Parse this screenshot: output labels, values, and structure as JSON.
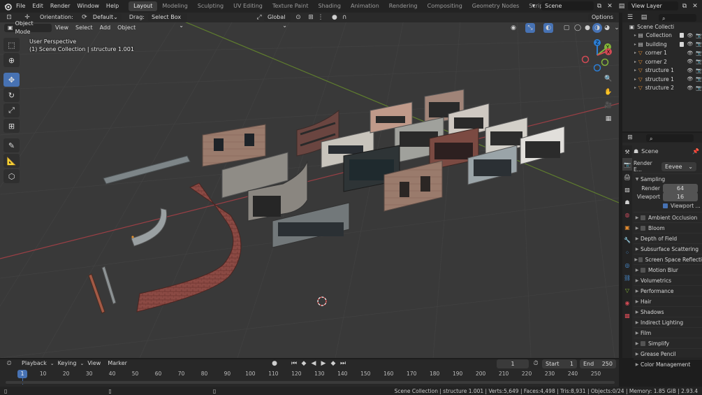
{
  "topbar": {
    "menus": [
      "File",
      "Edit",
      "Render",
      "Window",
      "Help"
    ],
    "workspaces": [
      "Layout",
      "Modeling",
      "Sculpting",
      "UV Editing",
      "Texture Paint",
      "Shading",
      "Animation",
      "Rendering",
      "Compositing",
      "Geometry Nodes",
      "Scripting"
    ],
    "active_workspace": "Layout",
    "add_workspace": "+",
    "scene": "Scene",
    "view_layer": "View Layer"
  },
  "tool_header": {
    "orientation_label": "Orientation:",
    "orientation_value": "Default",
    "drag_label": "Drag:",
    "drag_value": "Select Box",
    "transform_orientation": "Global",
    "options": "Options"
  },
  "viewport_header": {
    "mode": "Object Mode",
    "menus": [
      "View",
      "Select",
      "Add",
      "Object"
    ]
  },
  "viewport_overlay": {
    "line1": "User Perspective",
    "line2": "(1) Scene Collection | structure 1.001"
  },
  "gizmo": {
    "z": "Z",
    "y": "Y",
    "x": "X"
  },
  "outliner": {
    "root": "Scene Collecti",
    "items": [
      {
        "label": "Collection",
        "type": "collection"
      },
      {
        "label": "building",
        "type": "collection"
      },
      {
        "label": "corner 1",
        "type": "mesh"
      },
      {
        "label": "corner 2",
        "type": "mesh"
      },
      {
        "label": "structure 1",
        "type": "mesh"
      },
      {
        "label": "structure 1",
        "type": "mesh"
      },
      {
        "label": "structure 2",
        "type": "mesh"
      }
    ]
  },
  "properties": {
    "context": "Scene",
    "render_engine_label": "Render E...",
    "render_engine_value": "Eevee",
    "sampling_label": "Sampling",
    "render_label": "Render",
    "render_samples": "64",
    "viewport_label": "Viewport",
    "viewport_samples": "16",
    "viewport_denoise": "Viewport ...",
    "sections": [
      {
        "label": "Ambient Occlusion",
        "checkbox": true
      },
      {
        "label": "Bloom",
        "checkbox": true
      },
      {
        "label": "Depth of Field",
        "checkbox": false
      },
      {
        "label": "Subsurface Scattering",
        "checkbox": false
      },
      {
        "label": "Screen Space Reflecti",
        "checkbox": true
      },
      {
        "label": "Motion Blur",
        "checkbox": true
      },
      {
        "label": "Volumetrics",
        "checkbox": false
      },
      {
        "label": "Performance",
        "checkbox": false
      },
      {
        "label": "Hair",
        "checkbox": false
      },
      {
        "label": "Shadows",
        "checkbox": false
      },
      {
        "label": "Indirect Lighting",
        "checkbox": false
      },
      {
        "label": "Film",
        "checkbox": false
      },
      {
        "label": "Simplify",
        "checkbox": true
      },
      {
        "label": "Grease Pencil",
        "checkbox": false
      },
      {
        "label": "Color Management",
        "checkbox": false
      }
    ]
  },
  "timeline": {
    "menus": [
      "Playback",
      "Keying",
      "View",
      "Marker"
    ],
    "current_frame": "1",
    "start_label": "Start",
    "start_value": "1",
    "end_label": "End",
    "end_value": "250",
    "ruler": [
      "1",
      "10",
      "20",
      "30",
      "40",
      "50",
      "60",
      "70",
      "80",
      "90",
      "100",
      "110",
      "120",
      "130",
      "140",
      "150",
      "160",
      "170",
      "180",
      "190",
      "200",
      "210",
      "220",
      "230",
      "240",
      "250"
    ]
  },
  "statusbar": {
    "text": "Scene Collection | structure 1.001 | Verts:5,649 | Faces:4,498 | Tris:8,931 | Objects:0/24 | Memory: 1.85 GiB | 2.93.4"
  },
  "colors": {
    "accent": "#4772b3",
    "viewport_bg": "#393939",
    "panel_bg": "#282828",
    "x_axis": "#d24a54",
    "y_axis": "#84b53a",
    "z_axis": "#2c7fd6"
  }
}
